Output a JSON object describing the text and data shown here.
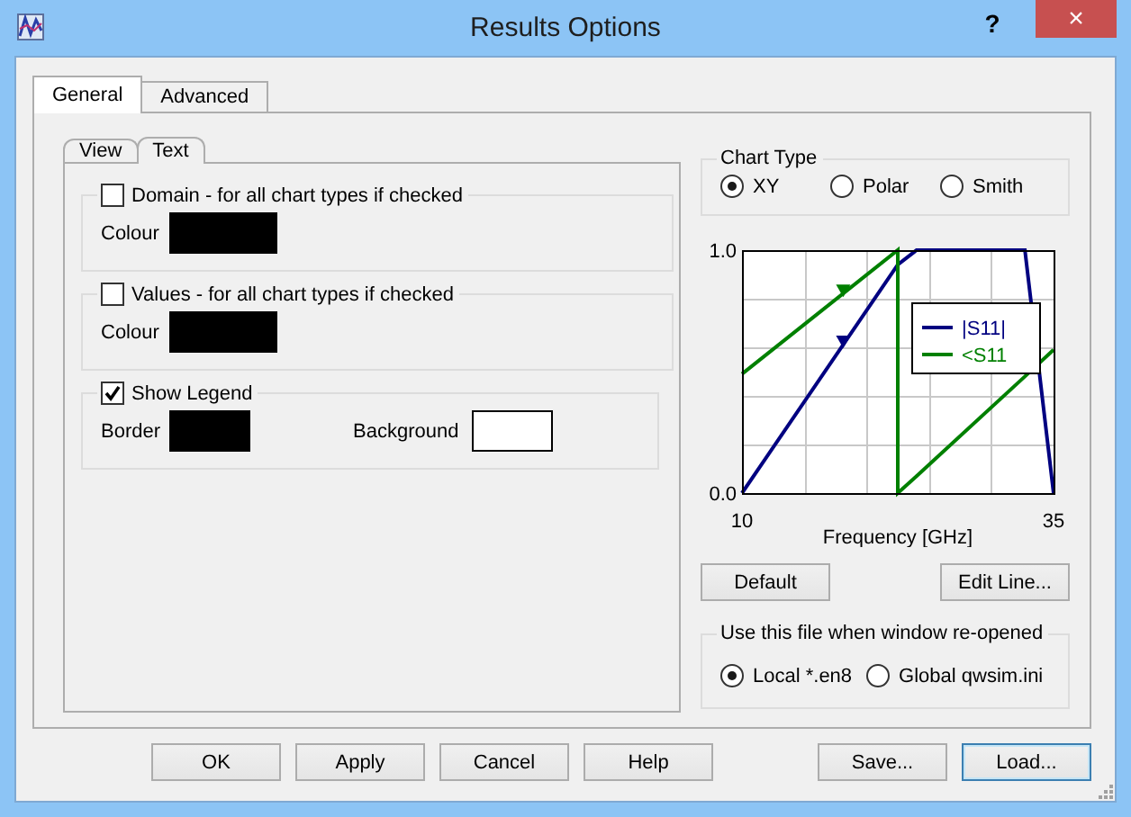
{
  "window": {
    "title": "Results Options",
    "help_button": "?",
    "close_button": "×"
  },
  "tabs": [
    {
      "label": "General",
      "selected": true
    },
    {
      "label": "Advanced",
      "selected": false
    }
  ],
  "subtabs": [
    {
      "label": "View",
      "selected": false
    },
    {
      "label": "Text",
      "selected": true
    }
  ],
  "text_groups": [
    {
      "label": "Domain - for all chart types if checked",
      "checked": false,
      "swatches": [
        {
          "label": "Colour",
          "color": "#000000"
        }
      ]
    },
    {
      "label": "Values - for all chart types if checked",
      "checked": false,
      "swatches": [
        {
          "label": "Colour",
          "color": "#000000"
        }
      ]
    },
    {
      "label": "Show Legend",
      "checked": true,
      "swatches": [
        {
          "label": "Border",
          "color": "#000000"
        },
        {
          "label": "Background",
          "color": "#ffffff"
        }
      ]
    }
  ],
  "chart_type": {
    "title": "Chart Type",
    "options": [
      {
        "label": "XY",
        "selected": true
      },
      {
        "label": "Polar",
        "selected": false
      },
      {
        "label": "Smith",
        "selected": false
      }
    ]
  },
  "chart_data": {
    "type": "line",
    "xlabel": "Frequency [GHz]",
    "x": [
      10,
      22.5,
      22.5,
      24,
      32.7,
      35
    ],
    "xlim": [
      10,
      35
    ],
    "ylim": [
      0,
      1
    ],
    "xticks": [
      10,
      35
    ],
    "yticks": [
      {
        "value": 0,
        "label": "0.0"
      },
      {
        "value": 1,
        "label": "1.0"
      }
    ],
    "legend": true,
    "series": [
      {
        "name": "|S11|",
        "color": "#000080",
        "values": [
          0,
          0.94,
          0.94,
          1,
          1,
          0
        ]
      },
      {
        "name": "<S11",
        "color": "#008000",
        "values": [
          0.49,
          1,
          0,
          0.07,
          0.48,
          0.59
        ]
      }
    ]
  },
  "chart_buttons": [
    {
      "label": "Default"
    },
    {
      "label": "Edit Line..."
    }
  ],
  "file_group": {
    "title": "Use this file when window re-opened",
    "options": [
      {
        "label": "Local *.en8",
        "selected": true
      },
      {
        "label": "Global qwsim.ini",
        "selected": false
      }
    ]
  },
  "buttons": [
    {
      "label": "OK",
      "default": false
    },
    {
      "label": "Apply",
      "default": false
    },
    {
      "label": "Cancel",
      "default": false
    },
    {
      "label": "Help",
      "default": false
    }
  ],
  "file_buttons": [
    {
      "label": "Save...",
      "default": false
    },
    {
      "label": "Load...",
      "default": true
    }
  ]
}
